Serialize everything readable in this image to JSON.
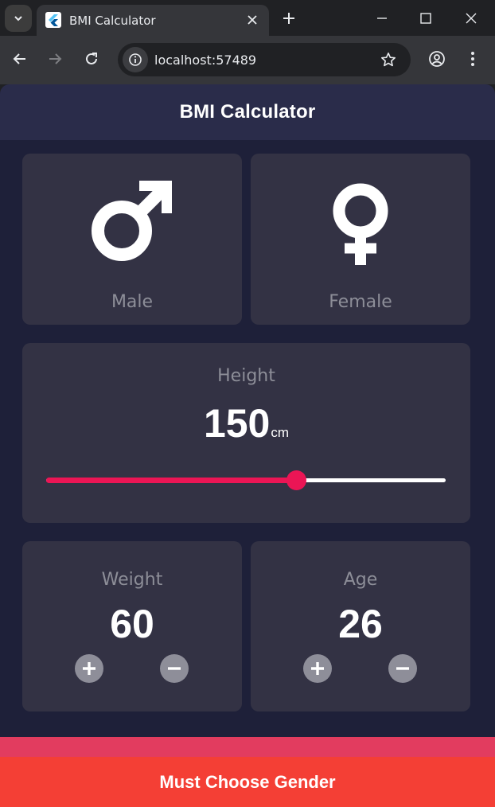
{
  "browser": {
    "tab_title": "BMI Calculator",
    "url": "localhost:57489",
    "icons": {
      "tab_search": "chevron-down-icon",
      "favicon": "flutter-icon",
      "tab_close": "close-icon",
      "new_tab": "plus-icon",
      "minimize": "minimize-icon",
      "maximize": "maximize-icon",
      "close_window": "close-icon",
      "back": "back-arrow-icon",
      "forward": "forward-arrow-icon",
      "reload": "reload-icon",
      "site_info": "info-icon",
      "bookmark": "star-icon",
      "profile": "profile-icon",
      "menu": "more-vertical-icon"
    }
  },
  "app": {
    "title": "BMI Calculator",
    "colors": {
      "background": "#1e2039",
      "appbar": "#2a2c4a",
      "card": "#333244",
      "label": "#8d8e98",
      "accent": "#eb1555",
      "button_red": "#f43f35"
    },
    "gender": {
      "male": {
        "label": "Male",
        "icon": "male-symbol-icon"
      },
      "female": {
        "label": "Female",
        "icon": "female-symbol-icon"
      }
    },
    "height": {
      "label": "Height",
      "value": "150",
      "unit": "cm",
      "slider_fraction": 0.625
    },
    "weight": {
      "label": "Weight",
      "value": "60",
      "increment_icon": "plus-icon",
      "decrement_icon": "minus-icon"
    },
    "age": {
      "label": "Age",
      "value": "26",
      "increment_icon": "plus-icon",
      "decrement_icon": "minus-icon"
    },
    "bottom_button": "Must Choose Gender"
  }
}
